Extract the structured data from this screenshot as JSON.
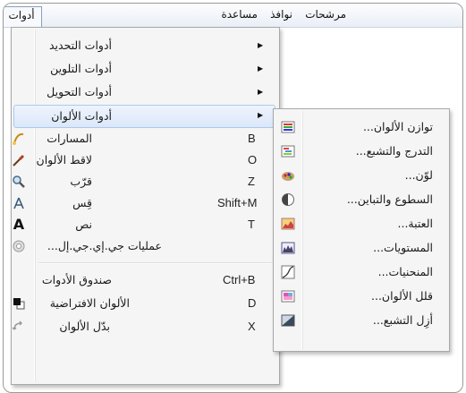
{
  "menubar": {
    "items": [
      "مساعدة",
      "نوافذ",
      "مرشحات",
      "أدوات"
    ]
  },
  "tools_menu": {
    "items": [
      {
        "label": "أدوات التحديد",
        "shortcut": "",
        "submenu": true
      },
      {
        "label": "أدوات التلوين",
        "shortcut": "",
        "submenu": true
      },
      {
        "label": "أدوات التحويل",
        "shortcut": "",
        "submenu": true
      },
      {
        "label": "أدوات الألوان",
        "shortcut": "",
        "submenu": true
      },
      {
        "label": "المسارات",
        "shortcut": "B",
        "icon": "paths-icon"
      },
      {
        "label": "لاقط الألوان",
        "shortcut": "O",
        "icon": "color-picker-icon"
      },
      {
        "label": "قرّب",
        "shortcut": "Z",
        "icon": "zoom-icon"
      },
      {
        "label": "قِس",
        "shortcut": "Shift+M",
        "icon": "measure-icon"
      },
      {
        "label": "نص",
        "shortcut": "T",
        "icon": "text-icon"
      },
      {
        "label": "عمليات جي.إي.جي.إل...",
        "shortcut": "",
        "icon": "gegl-icon"
      },
      {
        "label": "صندوق الأدوات",
        "shortcut": "Ctrl+B"
      },
      {
        "label": "الألوان الافتراضية",
        "shortcut": "D",
        "icon": "default-colors-icon"
      },
      {
        "label": "بدّل الألوان",
        "shortcut": "X",
        "icon": "swap-colors-icon"
      }
    ]
  },
  "colors_submenu": {
    "items": [
      {
        "label": "توازن الألوان...",
        "icon": "color-balance-icon"
      },
      {
        "label": "التدرج والتشبع...",
        "icon": "hue-saturation-icon"
      },
      {
        "label": "لوّن...",
        "icon": "colorize-icon"
      },
      {
        "label": "السطوع والتباين...",
        "icon": "brightness-contrast-icon"
      },
      {
        "label": "العتبة...",
        "icon": "threshold-icon"
      },
      {
        "label": "المستويات...",
        "icon": "levels-icon"
      },
      {
        "label": "المنحنيات...",
        "icon": "curves-icon"
      },
      {
        "label": "قلل الألوان...",
        "icon": "posterize-icon"
      },
      {
        "label": "أزِل التشبع...",
        "icon": "desaturate-icon"
      }
    ]
  },
  "colors": {
    "highlight": "#dbe7f9",
    "menu_bg": "#f5f5f5"
  }
}
